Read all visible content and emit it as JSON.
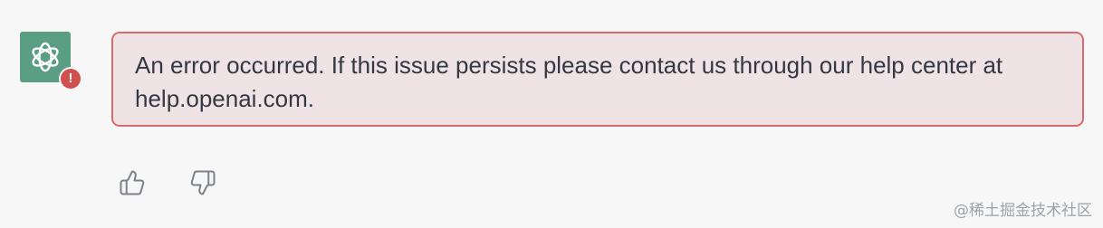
{
  "message": {
    "avatar_icon": "openai-logo-icon",
    "error_badge_icon": "exclamation-icon",
    "error_badge_text": "!",
    "text": "An error occurred. If this issue persists please contact us through our help center at help.openai.com."
  },
  "feedback": {
    "thumbs_up_icon": "thumbs-up-icon",
    "thumbs_down_icon": "thumbs-down-icon"
  },
  "watermark": "@稀土掘金技术社区",
  "colors": {
    "avatar_bg": "#5a9e83",
    "error_red": "#d0504f",
    "error_border": "#dc6a6c",
    "error_bg": "#f0e3e6",
    "page_bg": "#f7f7f8"
  }
}
